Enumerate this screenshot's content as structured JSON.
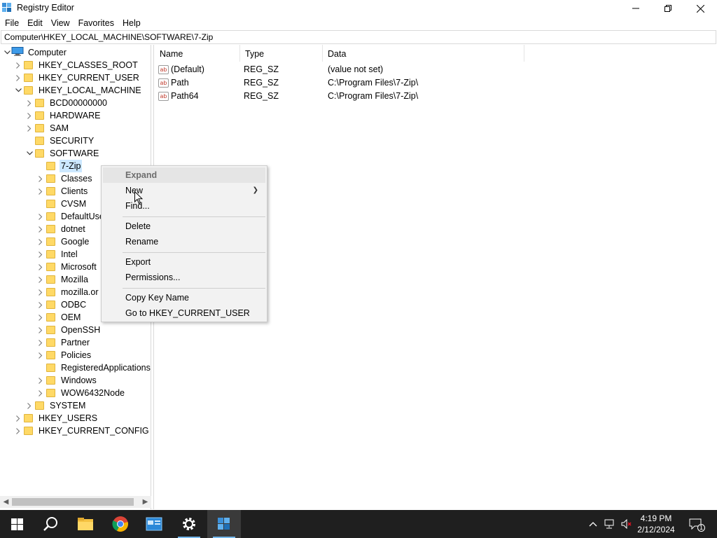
{
  "window": {
    "title": "Registry Editor",
    "minimize": "minimize",
    "maximize": "restore",
    "close": "close"
  },
  "menu": [
    "File",
    "Edit",
    "View",
    "Favorites",
    "Help"
  ],
  "address": "Computer\\HKEY_LOCAL_MACHINE\\SOFTWARE\\7-Zip",
  "tree": [
    {
      "label": "Computer",
      "level": 0,
      "chev": "down",
      "icon": "computer"
    },
    {
      "label": "HKEY_CLASSES_ROOT",
      "level": 1,
      "chev": "right"
    },
    {
      "label": "HKEY_CURRENT_USER",
      "level": 1,
      "chev": "right"
    },
    {
      "label": "HKEY_LOCAL_MACHINE",
      "level": 1,
      "chev": "down"
    },
    {
      "label": "BCD00000000",
      "level": 2,
      "chev": "right"
    },
    {
      "label": "HARDWARE",
      "level": 2,
      "chev": "right"
    },
    {
      "label": "SAM",
      "level": 2,
      "chev": "right"
    },
    {
      "label": "SECURITY",
      "level": 2,
      "chev": "none"
    },
    {
      "label": "SOFTWARE",
      "level": 2,
      "chev": "down"
    },
    {
      "label": "7-Zip",
      "level": 3,
      "chev": "none",
      "selected": true
    },
    {
      "label": "Classes",
      "level": 3,
      "chev": "right"
    },
    {
      "label": "Clients",
      "level": 3,
      "chev": "right"
    },
    {
      "label": "CVSM",
      "level": 3,
      "chev": "none"
    },
    {
      "label": "DefaultUse",
      "level": 3,
      "chev": "right"
    },
    {
      "label": "dotnet",
      "level": 3,
      "chev": "right"
    },
    {
      "label": "Google",
      "level": 3,
      "chev": "right"
    },
    {
      "label": "Intel",
      "level": 3,
      "chev": "right"
    },
    {
      "label": "Microsoft",
      "level": 3,
      "chev": "right"
    },
    {
      "label": "Mozilla",
      "level": 3,
      "chev": "right"
    },
    {
      "label": "mozilla.or",
      "level": 3,
      "chev": "right"
    },
    {
      "label": "ODBC",
      "level": 3,
      "chev": "right"
    },
    {
      "label": "OEM",
      "level": 3,
      "chev": "right"
    },
    {
      "label": "OpenSSH",
      "level": 3,
      "chev": "right"
    },
    {
      "label": "Partner",
      "level": 3,
      "chev": "right"
    },
    {
      "label": "Policies",
      "level": 3,
      "chev": "right"
    },
    {
      "label": "RegisteredApplications",
      "level": 3,
      "chev": "none"
    },
    {
      "label": "Windows",
      "level": 3,
      "chev": "right"
    },
    {
      "label": "WOW6432Node",
      "level": 3,
      "chev": "right"
    },
    {
      "label": "SYSTEM",
      "level": 2,
      "chev": "right"
    },
    {
      "label": "HKEY_USERS",
      "level": 1,
      "chev": "right"
    },
    {
      "label": "HKEY_CURRENT_CONFIG",
      "level": 1,
      "chev": "right"
    }
  ],
  "columns": {
    "name": "Name",
    "type": "Type",
    "data": "Data"
  },
  "values": [
    {
      "name": "(Default)",
      "type": "REG_SZ",
      "data": "(value not set)"
    },
    {
      "name": "Path",
      "type": "REG_SZ",
      "data": "C:\\Program Files\\7-Zip\\"
    },
    {
      "name": "Path64",
      "type": "REG_SZ",
      "data": "C:\\Program Files\\7-Zip\\"
    }
  ],
  "icon_text": "ab",
  "context_menu": {
    "expand": "Expand",
    "new": "New",
    "find": "Find...",
    "delete": "Delete",
    "rename": "Rename",
    "export": "Export",
    "permissions": "Permissions...",
    "copy_key_name": "Copy Key Name",
    "goto": "Go to HKEY_CURRENT_USER"
  },
  "taskbar": {
    "time": "4:19 PM",
    "date": "2/12/2024",
    "notifications": "1"
  },
  "colors": {
    "selection": "#cce8ff",
    "taskbar": "#1f1f1f",
    "accent": "#76b9ed"
  }
}
